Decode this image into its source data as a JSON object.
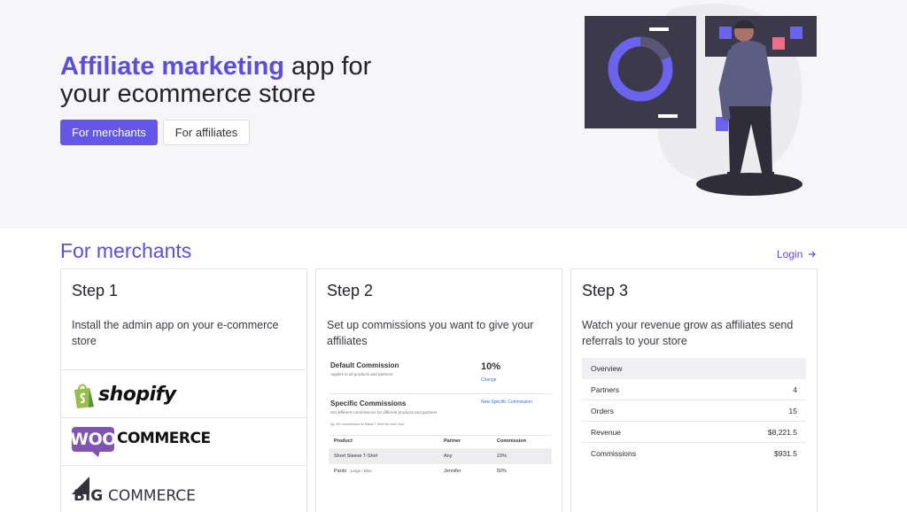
{
  "hero": {
    "title_accent": "Affiliate marketing",
    "title_rest_line1": " app for",
    "title_line2": "your ecommerce store",
    "button_merchants": "For merchants",
    "button_affiliates": "For affiliates"
  },
  "section": {
    "title": "For merchants",
    "login_label": "Login"
  },
  "steps": [
    {
      "title": "Step 1",
      "description": "Install the admin app on your e-commerce store"
    },
    {
      "title": "Step 2",
      "description": "Set up commissions you want to give your affiliates"
    },
    {
      "title": "Step 3",
      "description": "Watch your revenue grow as affiliates send referrals to your store"
    }
  ],
  "platforms": {
    "shopify": "shopify",
    "woo_badge": "WOO",
    "woo_text": "COMMERCE",
    "big_text": "BIG",
    "bigcommerce_text": "COMMERCE"
  },
  "commission_preview": {
    "default_title": "Default Commission",
    "default_sub": "Applies to all products and partners",
    "default_value": "10%",
    "change_link": "Change",
    "specific_title": "Specific Commissions",
    "specific_sub": "Set different commissions for different products and partners",
    "specific_example": "eg. 8% commission on Black T-Shirt for John Doe",
    "new_link": "New Specific Commission",
    "columns": [
      "Product",
      "Partner",
      "Commission"
    ],
    "rows": [
      {
        "product": "Short Sleeve T-Shirt",
        "variant": "",
        "partner": "Any",
        "commission": "23%"
      },
      {
        "product": "Pants",
        "variant": "Large / Blue",
        "partner": "Jennifer",
        "commission": "50%"
      }
    ]
  },
  "overview": {
    "header": "Overview",
    "rows": [
      {
        "label": "Partners",
        "value": "4"
      },
      {
        "label": "Orders",
        "value": "15"
      },
      {
        "label": "Revenue",
        "value": "$8,221.5"
      },
      {
        "label": "Commissions",
        "value": "$931.5"
      }
    ]
  },
  "colors": {
    "accent": "#5a4ee0",
    "button_primary": "#6457e8",
    "hero_bg": "#f6f6f9",
    "shopify_green": "#95bf47",
    "woo_purple": "#7f54b3"
  }
}
